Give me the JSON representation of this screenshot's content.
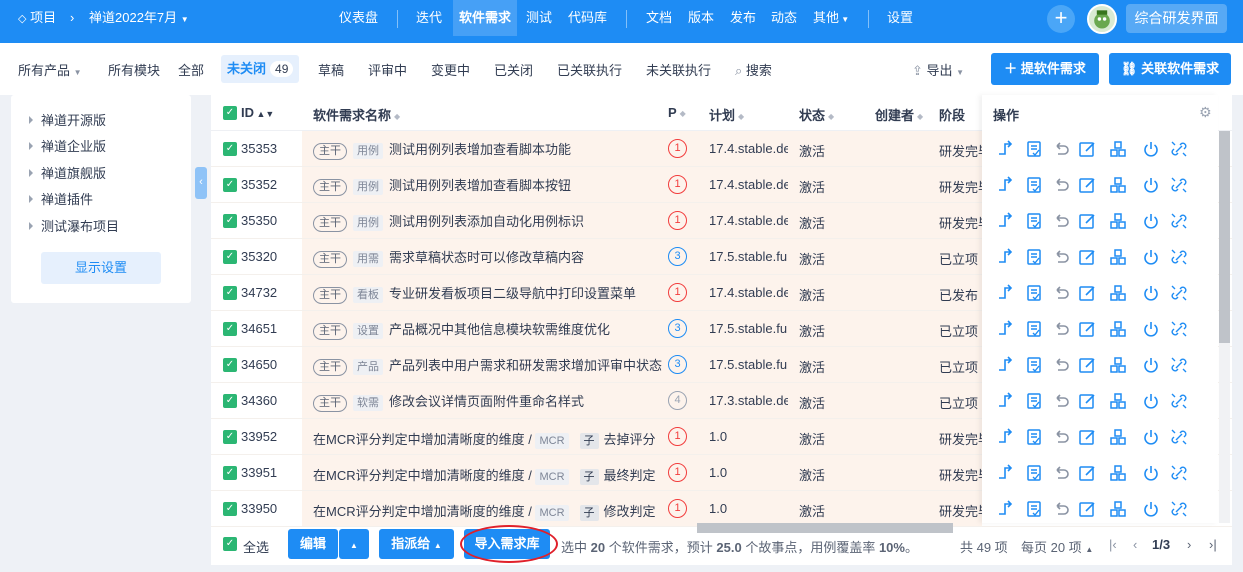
{
  "topbar": {
    "project_label": "项目",
    "project_name": "禅道2022年7月",
    "nav": [
      "仪表盘",
      "迭代",
      "软件需求",
      "测试",
      "代码库",
      "文档",
      "版本",
      "发布",
      "动态",
      "其他",
      "设置"
    ],
    "active_nav": "软件需求",
    "right_button": "综合研发界面"
  },
  "filters": {
    "product": "所有产品",
    "module": "所有模块",
    "all": "全部",
    "active_label": "未关闭",
    "active_count": "49",
    "tabs": [
      "草稿",
      "评审中",
      "变更中",
      "已关闭",
      "已关联执行",
      "未关联执行"
    ],
    "search": "搜索",
    "export": "导出",
    "btn_create": "提软件需求",
    "btn_link": "关联软件需求"
  },
  "sidebar": {
    "items": [
      "禅道开源版",
      "禅道企业版",
      "禅道旗舰版",
      "禅道插件",
      "测试瀑布项目"
    ],
    "settings_button": "显示设置"
  },
  "table": {
    "columns": {
      "id": "ID",
      "name": "软件需求名称",
      "pri": "P",
      "plan": "计划",
      "status": "状态",
      "creator": "创建者",
      "stage": "阶段",
      "actions": "操作"
    },
    "rows": [
      {
        "id": "35353",
        "branch": "主干",
        "module": "用例",
        "title": "测试用例列表增加查看脚本功能",
        "pri": "1",
        "plan": "17.4.stable.de",
        "status": "激活",
        "stage": "研发完毕"
      },
      {
        "id": "35352",
        "branch": "主干",
        "module": "用例",
        "title": "测试用例列表增加查看脚本按钮",
        "pri": "1",
        "plan": "17.4.stable.de",
        "status": "激活",
        "stage": "研发完毕"
      },
      {
        "id": "35350",
        "branch": "主干",
        "module": "用例",
        "title": "测试用例列表添加自动化用例标识",
        "pri": "1",
        "plan": "17.4.stable.de",
        "status": "激活",
        "stage": "研发完毕"
      },
      {
        "id": "35320",
        "branch": "主干",
        "module": "用需",
        "title": "需求草稿状态时可以修改草稿内容",
        "pri": "3",
        "plan": "17.5.stable.fu",
        "status": "激活",
        "stage": "已立项"
      },
      {
        "id": "34732",
        "branch": "主干",
        "module": "看板",
        "title": "专业研发看板项目二级导航中打印设置菜单",
        "pri": "1",
        "plan": "17.4.stable.de",
        "status": "激活",
        "stage": "已发布"
      },
      {
        "id": "34651",
        "branch": "主干",
        "module": "设置",
        "title": "产品概况中其他信息模块软需维度优化",
        "pri": "3",
        "plan": "17.5.stable.fu",
        "status": "激活",
        "stage": "已立项"
      },
      {
        "id": "34650",
        "branch": "主干",
        "module": "产品",
        "title": "产品列表中用户需求和研发需求增加评审中状态",
        "pri": "3",
        "plan": "17.5.stable.fu",
        "status": "激活",
        "stage": "已立项"
      },
      {
        "id": "34360",
        "branch": "主干",
        "module": "软需",
        "title": "修改会议详情页面附件重命名样式",
        "pri": "4",
        "plan": "17.3.stable.de",
        "status": "激活",
        "stage": "已立项"
      },
      {
        "id": "33952",
        "parent": "在MCR评分判定中增加清晰度的维度 /",
        "mtag": "MCR",
        "sub": "子",
        "title": "去掉评分",
        "pri": "1",
        "plan": "1.0",
        "status": "激活",
        "stage": "研发完毕"
      },
      {
        "id": "33951",
        "parent": "在MCR评分判定中增加清晰度的维度 /",
        "mtag": "MCR",
        "sub": "子",
        "title": "最终判定",
        "pri": "1",
        "plan": "1.0",
        "status": "激活",
        "stage": "研发完毕"
      },
      {
        "id": "33950",
        "parent": "在MCR评分判定中增加清晰度的维度 /",
        "mtag": "MCR",
        "sub": "子",
        "title": "修改判定",
        "pri": "1",
        "plan": "1.0",
        "status": "激活",
        "stage": "研发完毕"
      }
    ]
  },
  "footer": {
    "select_all": "全选",
    "edit": "编辑",
    "assign": "指派给",
    "import": "导入需求库",
    "summary_prefix": "选中",
    "selected_count": "20",
    "summary_mid1": "个软件需求，预计",
    "estimate": "25.0",
    "summary_mid2": "个故事点，用例覆盖率",
    "coverage": "10%",
    "summary_end": "。",
    "total": "共 49 项",
    "per_page": "每页 20 项",
    "page": "1/3"
  },
  "colors": {
    "primary": "#1e8cf4",
    "row_bg": "#fdf3ec",
    "p1": "#f23d3d",
    "p3": "#1e8cf4",
    "check": "#2bb673",
    "highlight": "#e0202a"
  }
}
